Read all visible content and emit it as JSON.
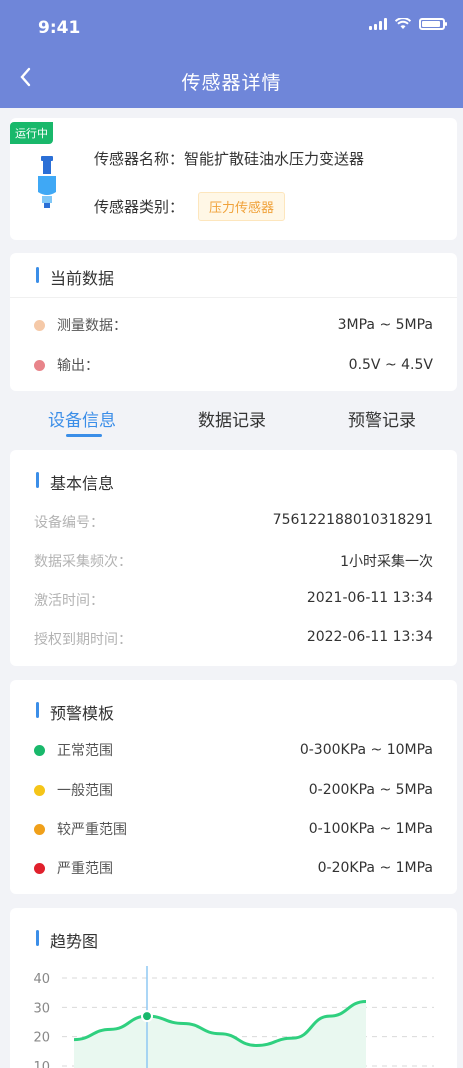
{
  "status_bar": {
    "time": "9:41"
  },
  "header": {
    "title": "传感器详情",
    "back_icon": "chevron-left-icon"
  },
  "sensor": {
    "status_badge": "运行中",
    "name_label": "传感器名称：智能扩散硅油水压力变送器",
    "category_label": "传感器类别：",
    "category_tag": "压力传感器",
    "status_color": "#19b86b"
  },
  "current_data": {
    "title": "当前数据",
    "rows": [
      {
        "label": "测量数据：",
        "value": "3MPa ~ 5MPa",
        "color": "#f5c9a8"
      },
      {
        "label": "输出：",
        "value": "0.5V ~ 4.5V",
        "color": "#e8848a"
      }
    ]
  },
  "tabs": [
    {
      "label": "设备信息",
      "active": true
    },
    {
      "label": "数据记录",
      "active": false
    },
    {
      "label": "预警记录",
      "active": false
    }
  ],
  "basic_info": {
    "title": "基本信息",
    "rows": [
      {
        "label": "设备编号：",
        "value": "756122188010318291"
      },
      {
        "label": "数据采集频次：",
        "value": "1小时采集一次"
      },
      {
        "label": "激活时间：",
        "value": "2021-06-11 13:34"
      },
      {
        "label": "授权到期时间：",
        "value": "2022-06-11 13:34"
      }
    ]
  },
  "warning_template": {
    "title": "预警模板",
    "rows": [
      {
        "label": "正常范围",
        "value": "0-300KPa ~ 10MPa",
        "color": "#19b86b"
      },
      {
        "label": "一般范围",
        "value": "0-200KPa ~ 5MPa",
        "color": "#f5c518"
      },
      {
        "label": "较严重范围",
        "value": "0-100KPa ~ 1MPa",
        "color": "#f0a01a"
      },
      {
        "label": "严重范围",
        "value": "0-20KPa ~ 1MPa",
        "color": "#e0202c"
      }
    ]
  },
  "trend": {
    "title": "趋势图",
    "accent": "#3b8ee8"
  },
  "chart_data": {
    "type": "area",
    "title": "",
    "ylim": [
      10,
      40
    ],
    "yticks": [
      10,
      20,
      30,
      40
    ],
    "grid": true,
    "series": [
      {
        "values": [
          19,
          22.5,
          27,
          24.5,
          21,
          17,
          19.5,
          27,
          32
        ]
      }
    ],
    "highlight_index": 2,
    "line_color": "#2fd07f"
  }
}
